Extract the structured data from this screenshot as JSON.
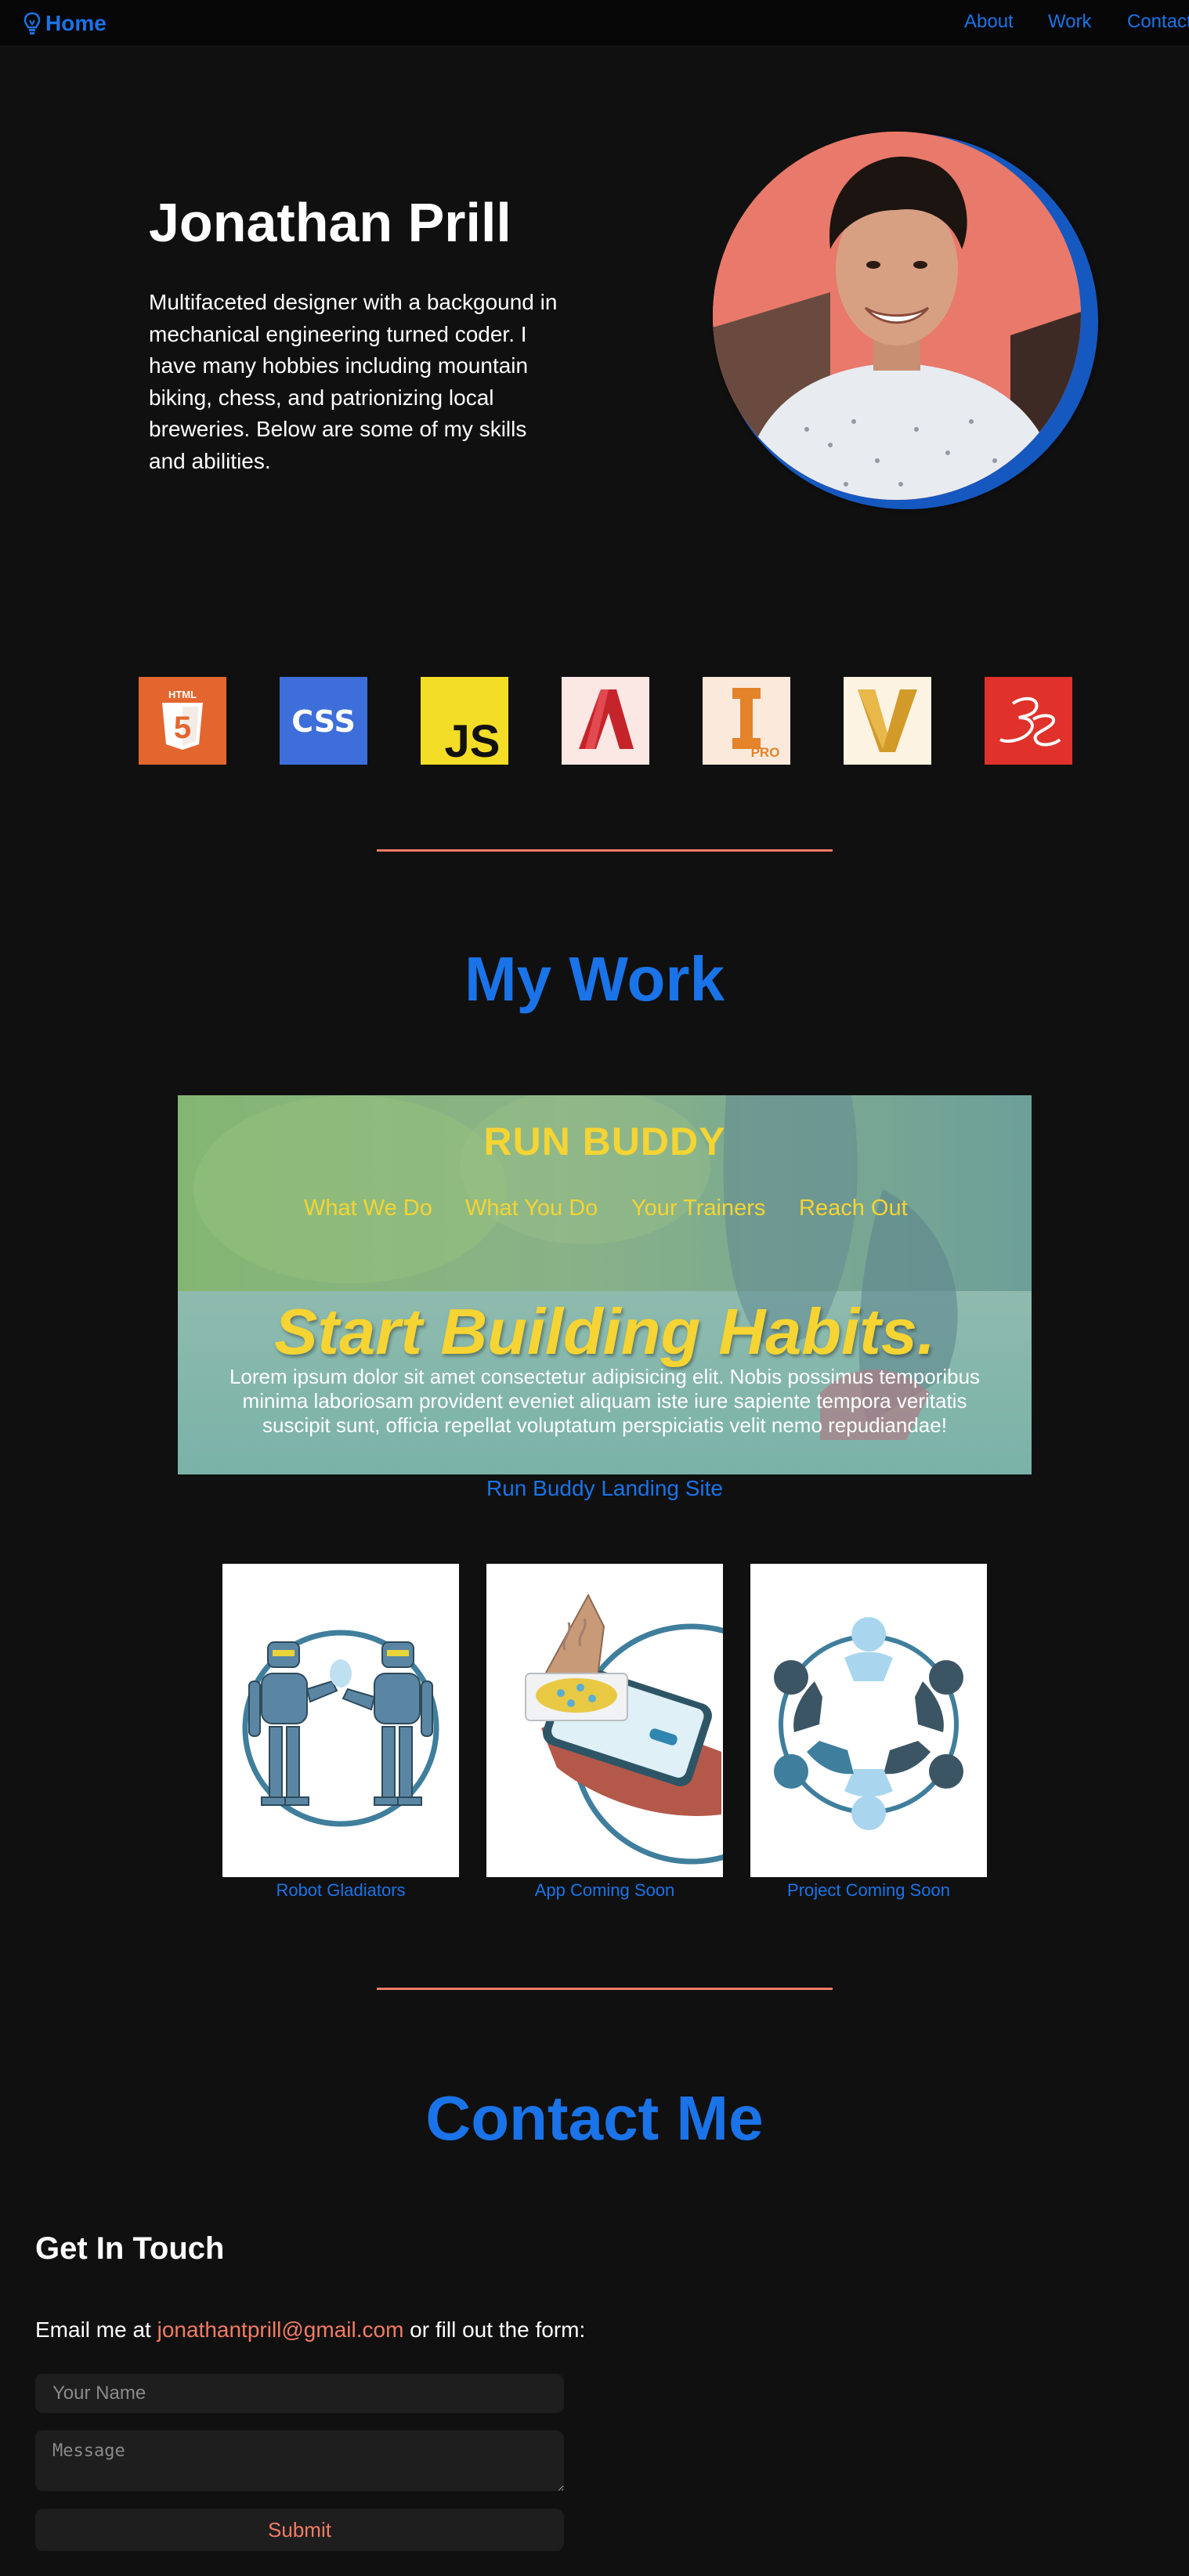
{
  "nav": {
    "home_label": "Home",
    "links": [
      "About",
      "Work",
      "Contact"
    ]
  },
  "hero": {
    "name": "Jonathan Prill",
    "bio": "Multifaceted designer with a backgound in mechanical engineering turned coder. I have many hobbies including mountain biking, chess, and patrionizing local breweries. Below are some of my skills and abilities."
  },
  "skills": [
    {
      "icon": "html5-icon",
      "label": "HTML",
      "color": "#e4662f"
    },
    {
      "icon": "css-icon",
      "label": "CSS",
      "color": "#3e6ed9"
    },
    {
      "icon": "javascript-icon",
      "label": "JS",
      "color": "#f3dd27"
    },
    {
      "icon": "autocad-icon",
      "color": "#c5242b"
    },
    {
      "icon": "inventor-pro-icon",
      "label": "PRO",
      "color": "#e4832a"
    },
    {
      "icon": "vault-icon",
      "color": "#d29a29"
    },
    {
      "icon": "dassault-3ds-icon",
      "color": "#e0312b"
    }
  ],
  "work": {
    "title": "My Work",
    "featured": {
      "brand": "RUN BUDDY",
      "nav": [
        "What We Do",
        "What You Do",
        "Your Trainers",
        "Reach Out"
      ],
      "headline": "Start Building Habits.",
      "body": "Lorem ipsum dolor sit amet consectetur adipisicing elit. Nobis possimus temporibus minima laboriosam provident eveniet aliquam iste iure sapiente tempora veritatis suscipit sunt, officia repellat voluptatum perspiciatis velit nemo repudiandae!",
      "caption": "Run Buddy Landing Site"
    },
    "projects": [
      {
        "caption": "Robot Gladiators",
        "icon": "robots-illustration"
      },
      {
        "caption": "App Coming Soon",
        "icon": "pizza-app-illustration"
      },
      {
        "caption": "Project Coming Soon",
        "icon": "team-circle-illustration"
      }
    ]
  },
  "contact": {
    "title": "Contact Me",
    "heading": "Get In Touch",
    "email_prefix": "Email me at ",
    "email": "jonathantprill@gmail.com",
    "email_suffix": " or fill out the form:",
    "name_placeholder": "Your Name",
    "message_placeholder": "Message",
    "submit_label": "Submit"
  },
  "colors": {
    "background": "#101010",
    "accent_blue": "#1a73e8",
    "accent_coral": "#f27b66",
    "runbuddy_yellow": "#f5d433"
  }
}
